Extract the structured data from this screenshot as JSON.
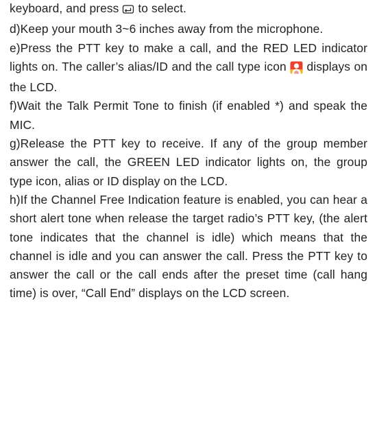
{
  "paragraphs": {
    "c_tail": {
      "before_icon": "keyboard, and press ",
      "after_icon": " to select."
    },
    "d": "d)Keep your mouth 3~6 inches away from the microphone.",
    "e": {
      "before_icon": "e)Press the PTT key to make a call, and the RED LED indicator lights on. The caller’s alias/ID and the call type icon ",
      "after_icon": " displays on the LCD."
    },
    "f": "f)Wait the Talk Permit Tone to finish (if enabled *) and speak the MIC.",
    "g": "g)Release the PTT key to receive. If any of the group member answer the call, the GREEN LED indicator lights on, the group type icon, alias or ID display on the LCD.",
    "h": "h)If the Channel Free Indication feature is enabled, you can hear a short alert tone when release the target radio’s PTT key, (the alert tone indicates that the channel is idle) which means that the channel is idle and you can answer the call. Press the PTT key to answer the call or the call ends after the preset time (call hang time) is over, “Call End” displays on the LCD screen."
  },
  "icons": {
    "ok_key": "ok-key-icon",
    "call_type": "private-call-type-icon",
    "call_type_colors": {
      "background": "#e8432e",
      "accent": "#f6b21a",
      "figure": "#ffffff"
    }
  }
}
